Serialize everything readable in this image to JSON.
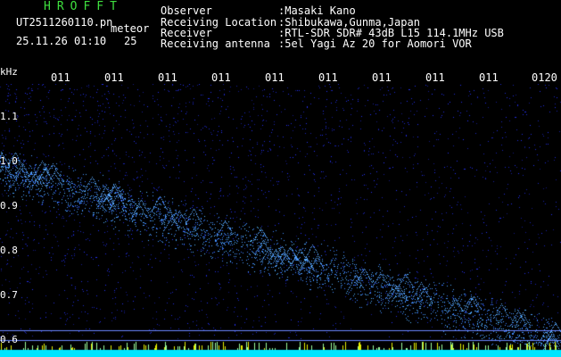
{
  "header": {
    "brand": "HROFFT",
    "filename": "UT2511260110.pn",
    "tag": "meteor",
    "date_time": "25.11.26 01:10",
    "count": "25",
    "info_labels": [
      "Observer",
      "Receiving Location",
      "Receiver",
      "Receiving antenna"
    ],
    "info_values": [
      ":Masaki Kano",
      ":Shibukawa,Gunma,Japan",
      ":RTL-SDR SDR# 43dB L15 114.1MHz USB",
      ":5el Yagi Az 20 for Aomori VOR"
    ]
  },
  "axis": {
    "unit": "kHz",
    "y_ticks": [
      "1.1",
      "1.0",
      "0.9",
      "0.8",
      "0.7",
      "0.6"
    ],
    "time_ticks": [
      "011",
      "011",
      "011",
      "011",
      "011",
      "011",
      "011",
      "011",
      "011",
      "0120"
    ]
  },
  "colors": {
    "background": "#000000",
    "noise": "#1e2dff",
    "signal": "#7fd0ff",
    "bottom_bar": "#00e5ff",
    "bottom_spikes": "#e8f000",
    "brand": "#3fe03f"
  }
}
